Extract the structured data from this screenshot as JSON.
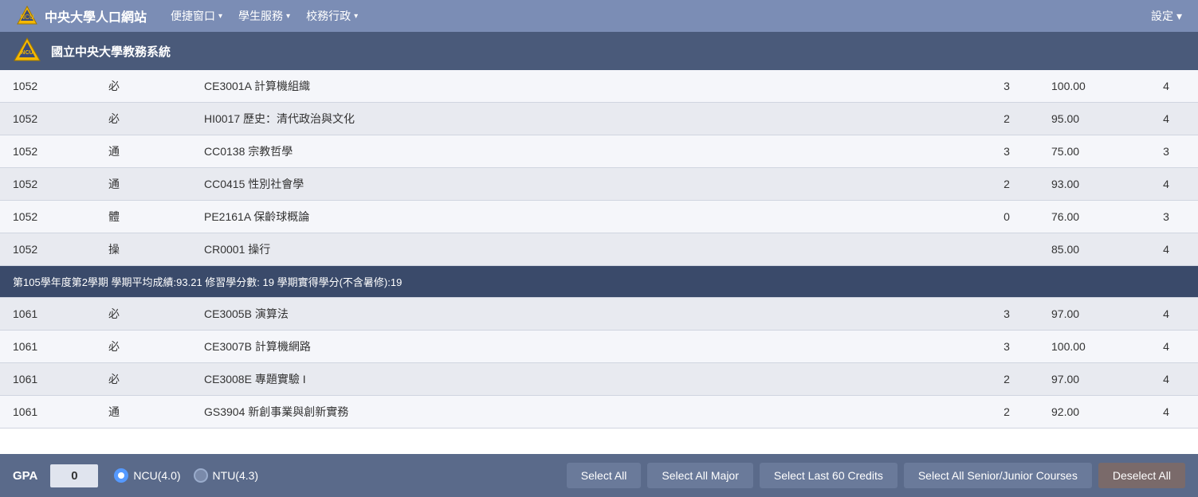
{
  "topNav": {
    "siteTitle": "中央大學人口網站",
    "menuItems": [
      {
        "label": "便捷窗口",
        "hasDropdown": true
      },
      {
        "label": "學生服務",
        "hasDropdown": true
      },
      {
        "label": "校務行政",
        "hasDropdown": true
      }
    ],
    "settingsLabel": "設定"
  },
  "subNav": {
    "schoolName": "國立中央大學教務系統"
  },
  "tableRows": [
    {
      "year": "1052",
      "type": "必",
      "course": "CE3001A 計算機組織",
      "credits": "3",
      "score": "100.00",
      "grade": "4"
    },
    {
      "year": "1052",
      "type": "必",
      "course": "HI0017 歷史：清代政治與文化",
      "credits": "2",
      "score": "95.00",
      "grade": "4"
    },
    {
      "year": "1052",
      "type": "通",
      "course": "CC0138 宗教哲學",
      "credits": "3",
      "score": "75.00",
      "grade": "3"
    },
    {
      "year": "1052",
      "type": "通",
      "course": "CC0415 性別社會學",
      "credits": "2",
      "score": "93.00",
      "grade": "4"
    },
    {
      "year": "1052",
      "type": "體",
      "course": "PE2161A 保齡球概論",
      "credits": "0",
      "score": "76.00",
      "grade": "3"
    },
    {
      "year": "1052",
      "type": "操",
      "course": "CR0001 操行",
      "credits": "",
      "score": "85.00",
      "grade": "4"
    }
  ],
  "summaryRow": {
    "text": "第105學年度第2學期 學期平均成績:93.21 修習學分數: 19 學期實得學分(不含暑修):19"
  },
  "tableRows2": [
    {
      "year": "1061",
      "type": "必",
      "course": "CE3005B 演算法",
      "credits": "3",
      "score": "97.00",
      "grade": "4"
    },
    {
      "year": "1061",
      "type": "必",
      "course": "CE3007B 計算機網路",
      "credits": "3",
      "score": "100.00",
      "grade": "4"
    },
    {
      "year": "1061",
      "type": "必",
      "course": "CE3008E 專題實驗 I",
      "credits": "2",
      "score": "97.00",
      "grade": "4"
    },
    {
      "year": "1061",
      "type": "通",
      "course": "GS3904 新創事業與創新實務",
      "credits": "2",
      "score": "92.00",
      "grade": "4"
    }
  ],
  "bottomBar": {
    "gpaLabel": "GPA",
    "gpaValue": "0",
    "radioOptions": [
      {
        "label": "NCU(4.0)",
        "selected": true
      },
      {
        "label": "NTU(4.3)",
        "selected": false
      }
    ],
    "buttons": [
      {
        "id": "btn-select-all",
        "label": "Select All",
        "type": "primary"
      },
      {
        "id": "btn-select-all-major",
        "label": "Select All Major",
        "type": "primary"
      },
      {
        "id": "btn-select-last-60",
        "label": "Select Last 60 Credits",
        "type": "primary"
      },
      {
        "id": "btn-select-senior-junior",
        "label": "Select All Senior/Junior Courses",
        "type": "primary"
      },
      {
        "id": "btn-deselect-all",
        "label": "Deselect All",
        "type": "danger"
      }
    ]
  }
}
